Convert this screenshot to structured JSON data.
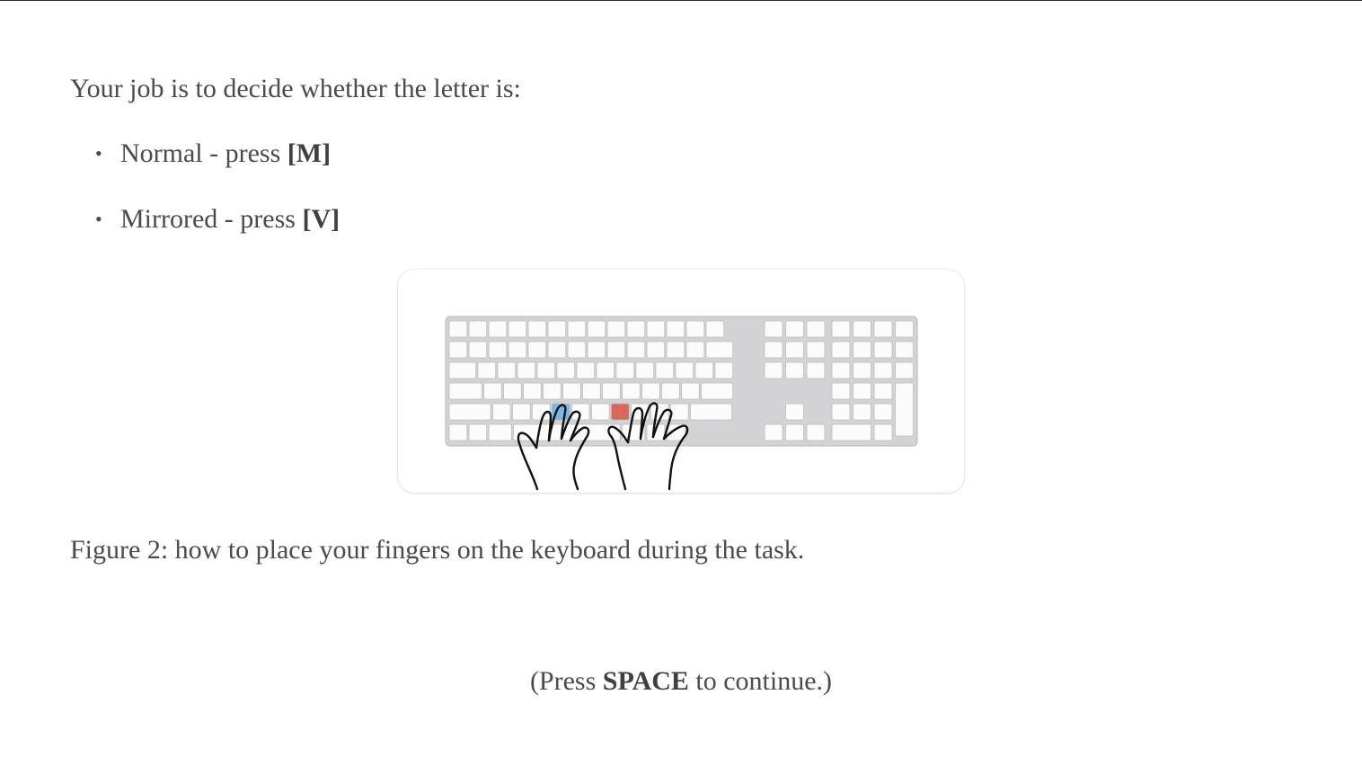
{
  "instructions": {
    "intro": "Your job is to decide whether the letter is:",
    "options": [
      {
        "label": "Normal - press ",
        "key": "[M]"
      },
      {
        "label": "Mirrored - press ",
        "key": "[V]"
      }
    ]
  },
  "figure": {
    "image": "keyboard-with-hands-icon",
    "highlighted_keys": [
      {
        "key": "V",
        "color": "#79b7e6"
      },
      {
        "key": "M",
        "color": "#d8685c"
      }
    ],
    "caption": "Figure 2: how to place your fingers on the keyboard during the task."
  },
  "footer": {
    "prefix": "(Press ",
    "key": "SPACE",
    "suffix": " to continue.)"
  },
  "colors": {
    "text": "#4a4a4f",
    "left_key": "#79b7e6",
    "right_key": "#d8685c"
  }
}
